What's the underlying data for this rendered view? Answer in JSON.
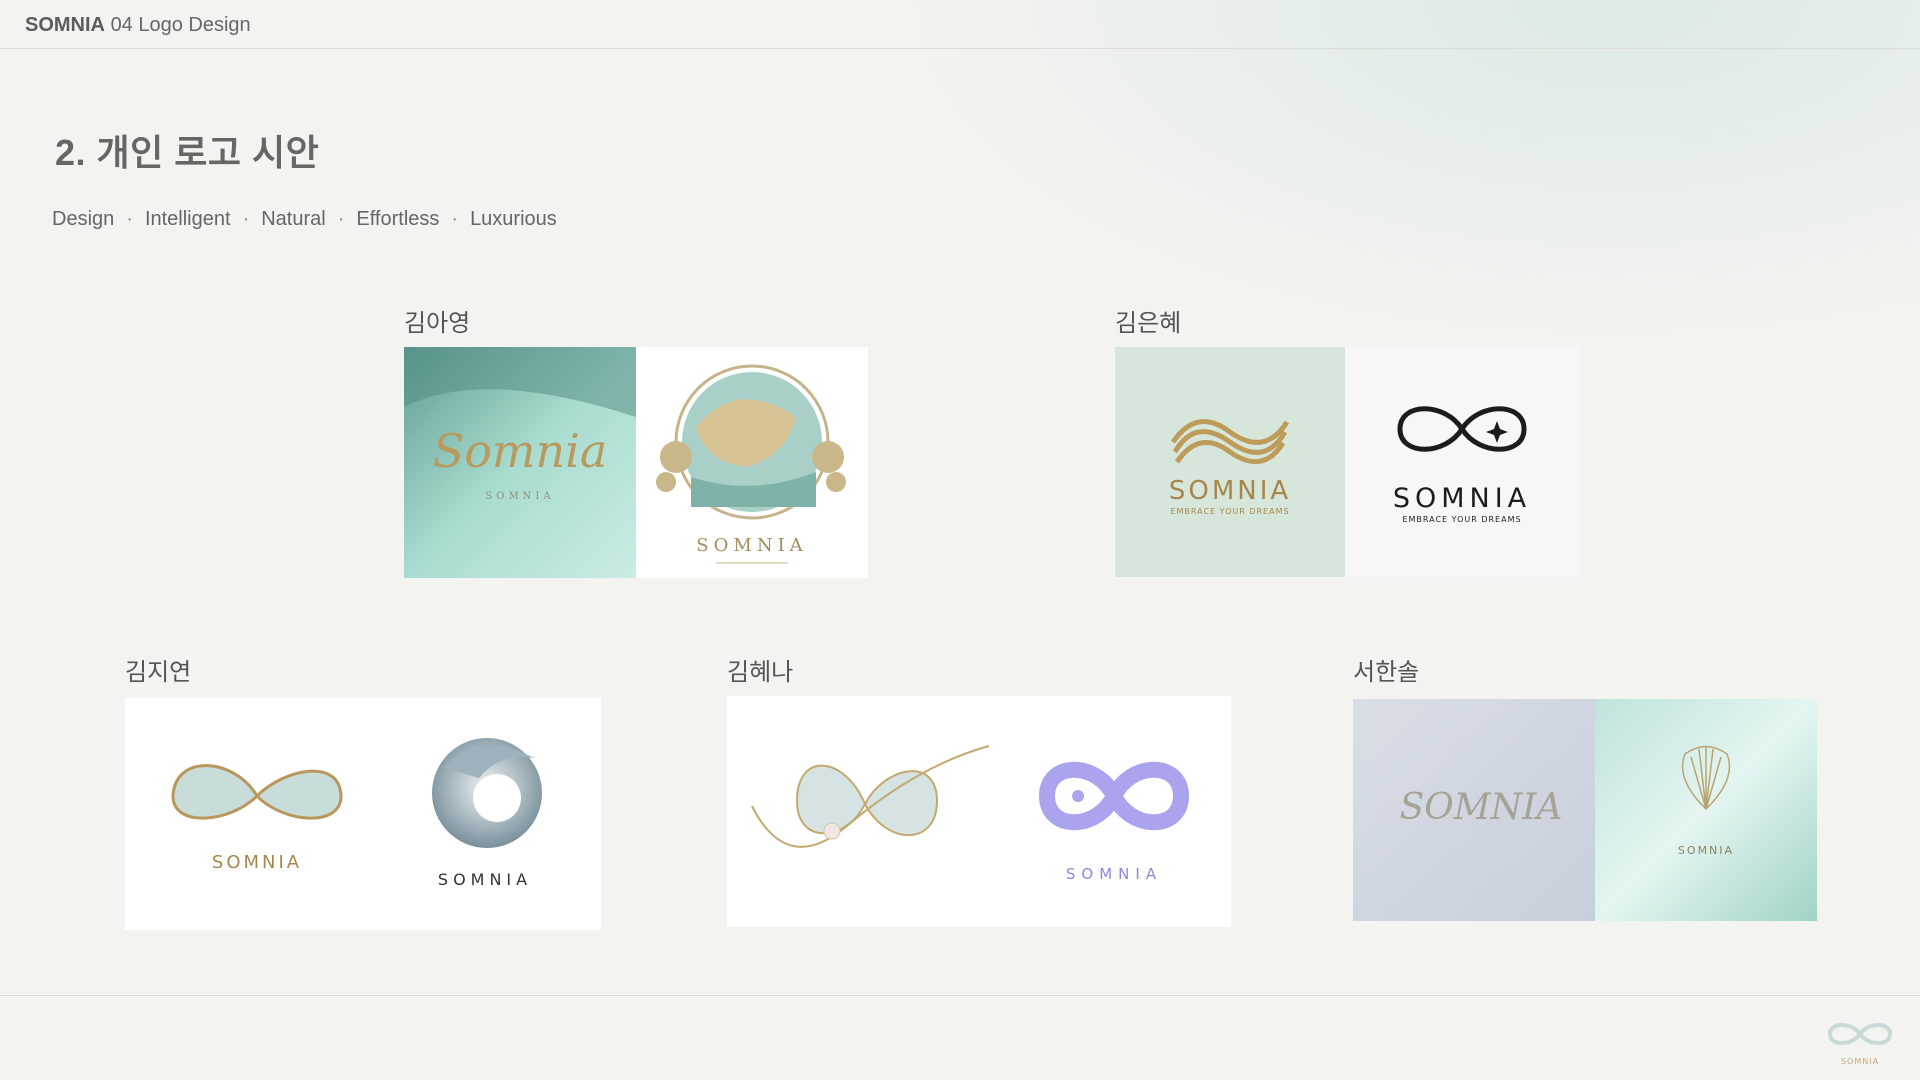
{
  "header": {
    "brand": "SOMNIA",
    "section": "04 Logo Design"
  },
  "page": {
    "title": "2. 개인 로고 시안",
    "keywords": [
      "Design",
      "Intelligent",
      "Natural",
      "Effortless",
      "Luxurious"
    ]
  },
  "members": [
    {
      "name": "김아영",
      "logos": [
        {
          "wordmark": "Somnia",
          "subtext": "SOMNIA"
        },
        {
          "wordmark": "SOMNIA"
        }
      ]
    },
    {
      "name": "김은혜",
      "logos": [
        {
          "wordmark": "SOMNIA",
          "tagline": "EMBRACE YOUR DREAMS"
        },
        {
          "wordmark": "SOMNIA",
          "tagline": "EMBRACE YOUR DREAMS"
        }
      ]
    },
    {
      "name": "김지연",
      "logos": [
        {
          "wordmark": "SOMNIA"
        },
        {
          "wordmark": "SOMNIA"
        }
      ]
    },
    {
      "name": "김혜나",
      "logos": [
        {
          "wordmark": ""
        },
        {
          "wordmark": "SOMNIA"
        }
      ]
    },
    {
      "name": "서한솔",
      "logos": [
        {
          "wordmark": "SOMNIA"
        },
        {
          "wordmark": "SOMNIA"
        }
      ]
    }
  ],
  "footer": {
    "logo_text": "SOMNIA"
  },
  "colors": {
    "background": "#f3f3ef",
    "gold": "#b89a5e",
    "mint": "#9fd3c7",
    "lavender": "#a9a3ee",
    "text": "#555555"
  }
}
